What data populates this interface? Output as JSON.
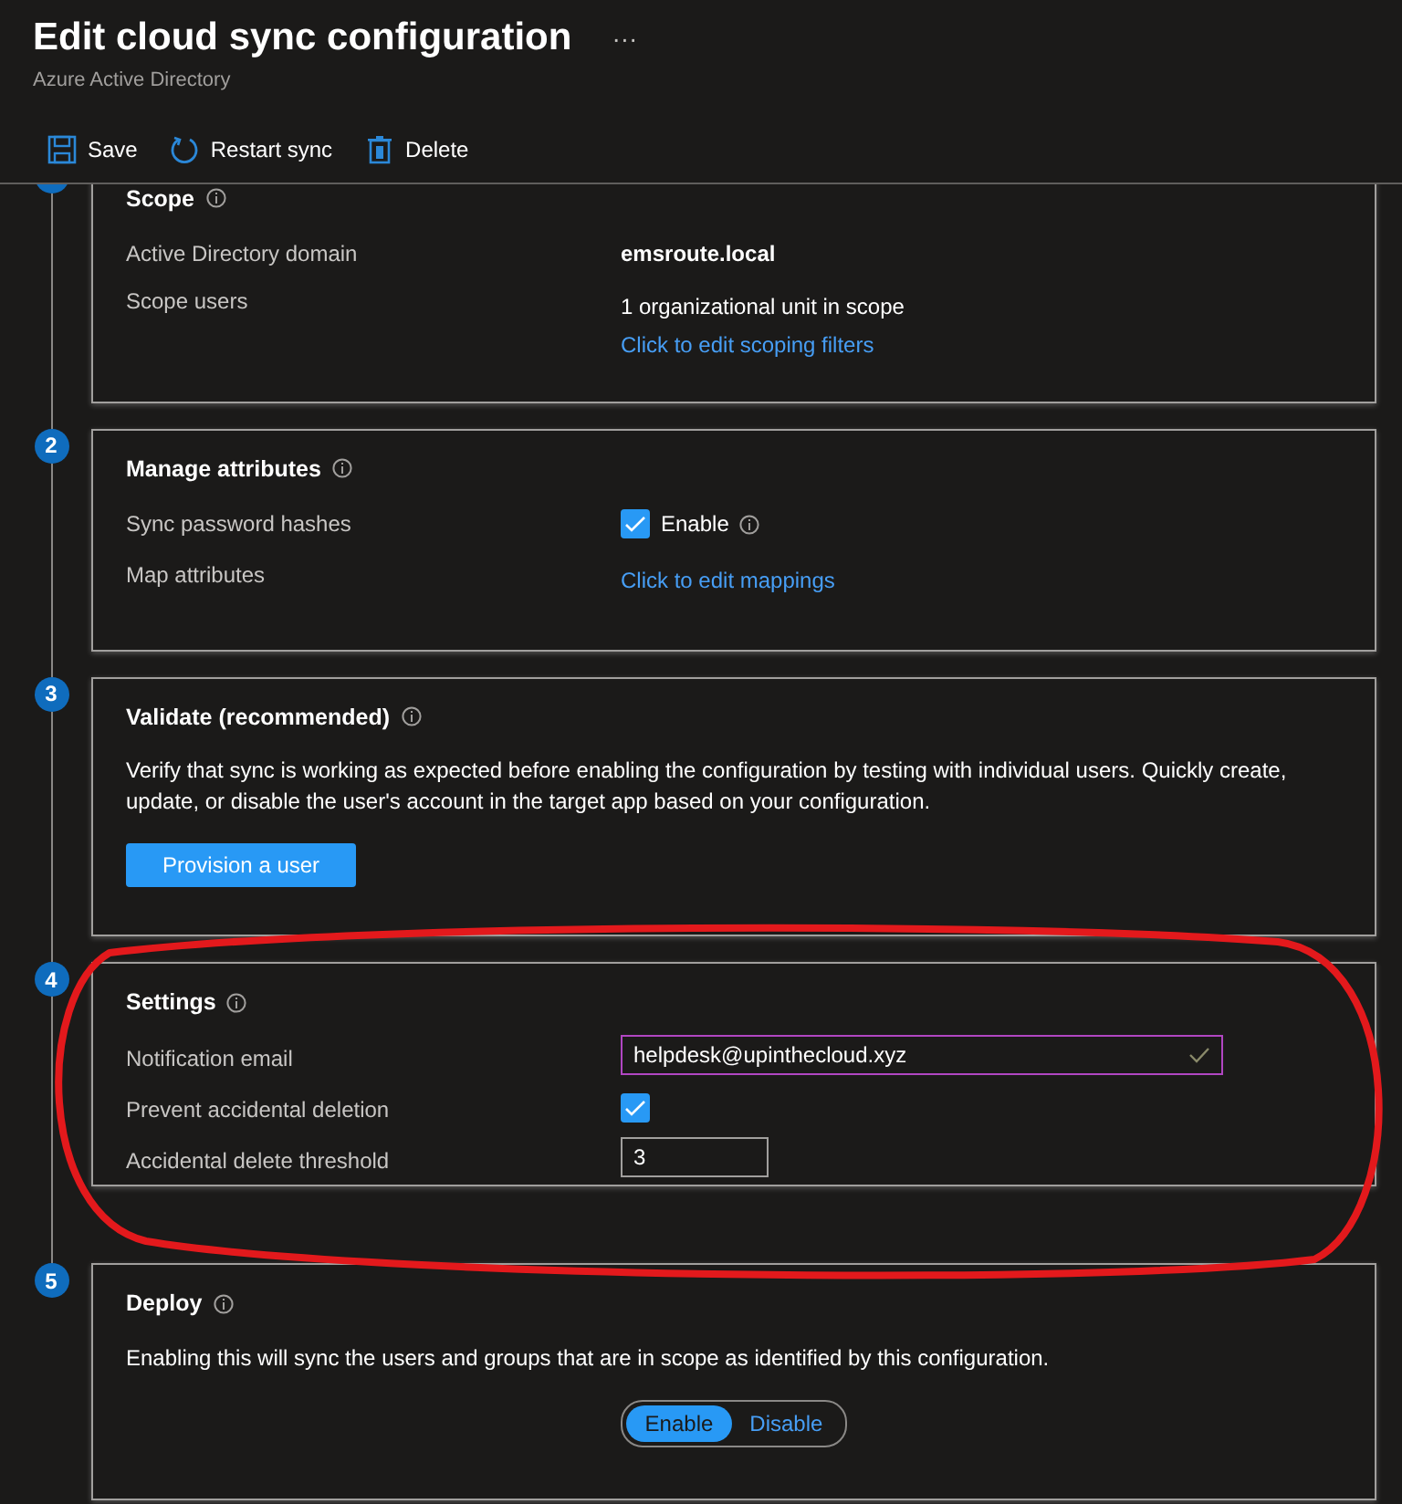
{
  "header": {
    "title": "Edit cloud sync configuration",
    "more": "···",
    "subtitle": "Azure Active Directory"
  },
  "toolbar": [
    {
      "kind": "save",
      "label": "Save"
    },
    {
      "kind": "restart",
      "label": "Restart sync"
    },
    {
      "kind": "delete",
      "label": "Delete"
    }
  ],
  "sections": [
    {
      "title": "Scope",
      "rows": [
        {
          "label": "Active Directory domain",
          "kind": "bold",
          "value": "emsroute.local"
        },
        {
          "label": "Scope users",
          "kind": "text-link",
          "value": "1 organizational unit in scope",
          "link": "Click to edit scoping filters"
        }
      ]
    },
    {
      "number": "2",
      "title": "Manage attributes",
      "rows": [
        {
          "label": "Sync password hashes",
          "kind": "checkbox",
          "checked": true,
          "value": "Enable",
          "info": true
        },
        {
          "label": "Map attributes",
          "kind": "link",
          "link": "Click to edit mappings"
        }
      ]
    },
    {
      "number": "3",
      "title": "Validate (recommended)",
      "description": "Verify that sync is working as expected before enabling the configuration by testing with individual users. Quickly create, update, or disable the user's account in the target app based on your configuration.",
      "button": "Provision a user"
    },
    {
      "number": "4",
      "title": "Settings",
      "rows": [
        {
          "label": "Notification email",
          "kind": "input",
          "value": "helpdesk@upinthecloud.xyz",
          "valid": true
        },
        {
          "label": "Prevent accidental deletion",
          "kind": "checkbox",
          "checked": true
        },
        {
          "label": "Accidental delete threshold",
          "kind": "number",
          "value": "3"
        }
      ]
    },
    {
      "number": "5",
      "title": "Deploy",
      "description": "Enabling this will sync the users and groups that are in scope as identified by this configuration.",
      "toggle": [
        {
          "label": "Enable",
          "selected": true
        },
        {
          "label": "Disable",
          "selected": false
        }
      ]
    }
  ],
  "annotation": {
    "kind": "ellipse"
  }
}
